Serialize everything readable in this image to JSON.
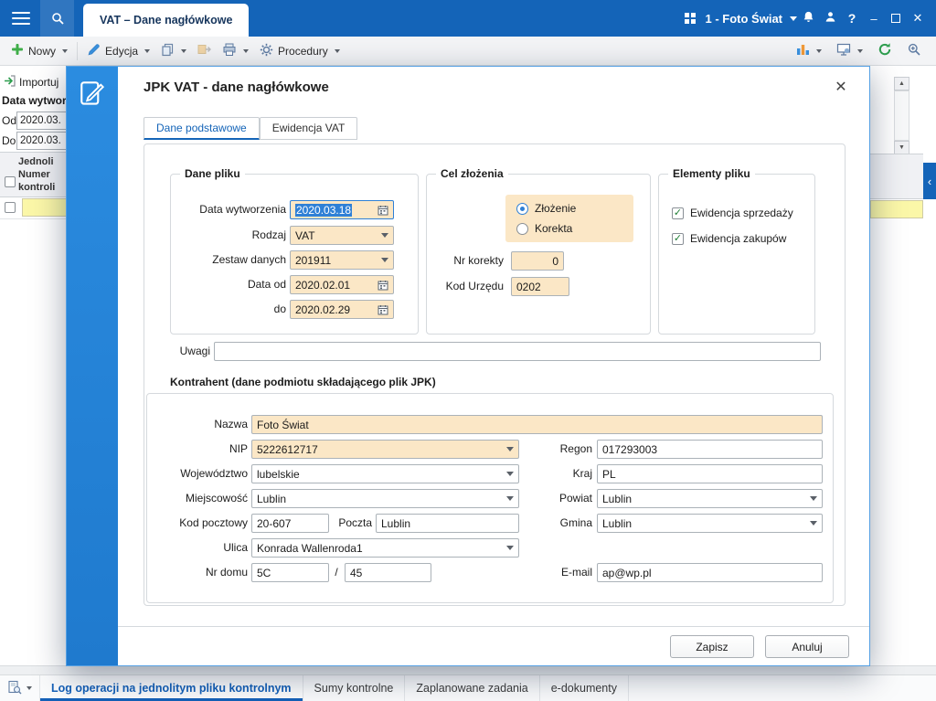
{
  "glyphs": {
    "close": "✕",
    "minimize": "–",
    "help": "?",
    "scroll_up": "▲",
    "scroll_down": "▼",
    "collapse_left": "‹",
    "slash": "/",
    "check": "✓"
  },
  "topbar": {
    "tab_title": "VAT – Dane nagłówkowe",
    "company": "1 - Foto Świat"
  },
  "toolbar": {
    "nowy": "Nowy",
    "edycja": "Edycja",
    "procedury": "Procedury"
  },
  "background": {
    "importuj": "Importuj",
    "filter_header": "Data wytworz",
    "od_label": "Od",
    "od_value": "2020.03.",
    "do_label": "Do",
    "do_value": "2020.03.",
    "grid_header": [
      "Jednoli",
      "Numer",
      "kontroli"
    ]
  },
  "dialog": {
    "title": "JPK VAT - dane nagłówkowe",
    "tabs": [
      {
        "label": "Dane podstawowe",
        "active": true
      },
      {
        "label": "Ewidencja VAT",
        "active": false
      }
    ],
    "dane_pliku": {
      "legend": "Dane pliku",
      "rows": [
        {
          "label": "Data wytworzenia",
          "value": "2020.03.18"
        },
        {
          "label": "Rodzaj",
          "value": "VAT"
        },
        {
          "label": "Zestaw danych",
          "value": "201911"
        },
        {
          "label": "Data od",
          "value": "2020.02.01"
        },
        {
          "label": "do",
          "value": "2020.02.29"
        }
      ]
    },
    "cel_zlozenia": {
      "legend": "Cel złożenia",
      "zlozenie": "Złożenie",
      "zlozenie_selected": true,
      "korekta": "Korekta",
      "korekta_selected": false,
      "nr_korekty_label": "Nr korekty",
      "nr_korekty": "0",
      "kod_urzedu_label": "Kod Urzędu",
      "kod_urzedu": "0202"
    },
    "elementy_pliku": {
      "legend": "Elementy pliku",
      "cb1": "Ewidencja sprzedaży",
      "cb1_checked": true,
      "cb2": "Ewidencja zakupów",
      "cb2_checked": true
    },
    "uwagi_label": "Uwagi",
    "uwagi": "",
    "kontrahent": {
      "legend": "Kontrahent (dane podmiotu składającego plik JPK)",
      "nazwa_label": "Nazwa",
      "nazwa": "Foto Świat",
      "nip_label": "NIP",
      "nip": "5222612717",
      "regon_label": "Regon",
      "regon": "017293003",
      "wojewodztwo_label": "Województwo",
      "wojewodztwo": "lubelskie",
      "kraj_label": "Kraj",
      "kraj": "PL",
      "miejscowosc_label": "Miejscowość",
      "miejscowosc": "Lublin",
      "powiat_label": "Powiat",
      "powiat": "Lublin",
      "kod_pocztowy_label": "Kod pocztowy",
      "kod_pocztowy": "20-607",
      "poczta_label": "Poczta",
      "poczta": "Lublin",
      "gmina_label": "Gmina",
      "gmina": "Lublin",
      "ulica_label": "Ulica",
      "ulica": "Konrada Wallenroda1",
      "nr_domu_label": "Nr domu",
      "nr_domu": "5C",
      "nr_lokalu": "45",
      "email_label": "E-mail",
      "email": "ap@wp.pl"
    },
    "buttons": {
      "zapisz": "Zapisz",
      "anuluj": "Anuluj"
    }
  },
  "bottom_tabs": [
    {
      "label": "Log operacji na jednolitym pliku kontrolnym",
      "active": true
    },
    {
      "label": "Sumy kontrolne",
      "active": false
    },
    {
      "label": "Zaplanowane zadania",
      "active": false
    },
    {
      "label": "e-dokumenty",
      "active": false
    }
  ]
}
